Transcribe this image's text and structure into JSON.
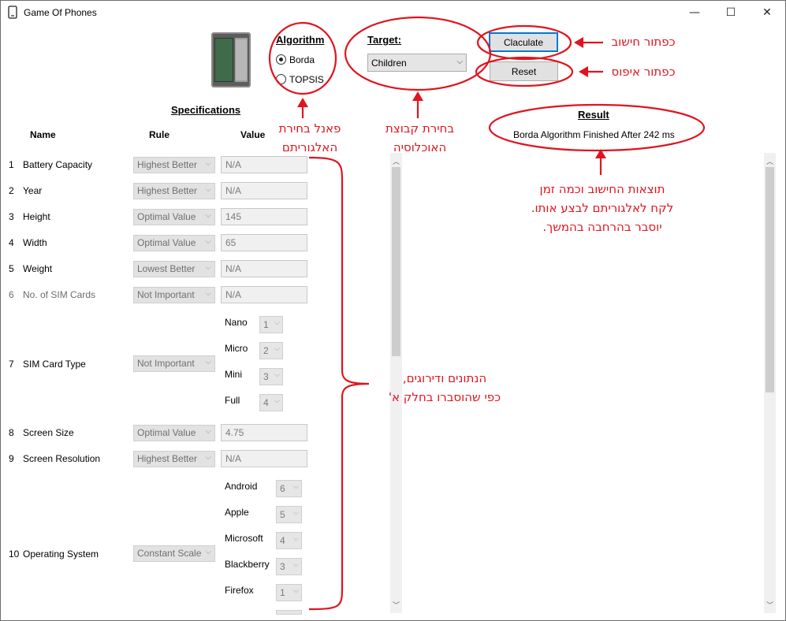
{
  "window": {
    "title": "Game Of Phones",
    "minimize_glyph": "—",
    "maximize_glyph": "☐",
    "close_glyph": "✕",
    "icon": "phone-icon"
  },
  "algorithm": {
    "heading": "Algorithm",
    "options": [
      {
        "label": "Borda",
        "selected": true
      },
      {
        "label": "TOPSIS",
        "selected": false
      }
    ]
  },
  "target": {
    "heading": "Target:",
    "selected": "Children"
  },
  "buttons": {
    "calculate": "Claculate",
    "reset": "Reset"
  },
  "result": {
    "heading": "Result",
    "text": "Borda Algorithm Finished After 242 ms"
  },
  "specs": {
    "heading": "Specifications",
    "columns": {
      "name": "Name",
      "rule": "Rule",
      "value": "Value"
    },
    "rows": [
      {
        "num": "1",
        "name": "Battery Capacity",
        "rule": "Highest Better",
        "value": "N/A"
      },
      {
        "num": "2",
        "name": "Year",
        "rule": "Highest Better",
        "value": "N/A"
      },
      {
        "num": "3",
        "name": "Height",
        "rule": "Optimal Value",
        "value": "145"
      },
      {
        "num": "4",
        "name": "Width",
        "rule": "Optimal Value",
        "value": "65"
      },
      {
        "num": "5",
        "name": "Weight",
        "rule": "Lowest Better",
        "value": "N/A"
      },
      {
        "num": "6",
        "name": "No. of SIM Cards",
        "rule": "Not Important",
        "value": "N/A"
      },
      {
        "num": "7",
        "name": "SIM Card Type",
        "rule": "Not Important"
      },
      {
        "num": "8",
        "name": "Screen Size",
        "rule": "Optimal Value",
        "value": "4.75"
      },
      {
        "num": "9",
        "name": "Screen Resolution",
        "rule": "Highest Better",
        "value": "N/A"
      },
      {
        "num": "10",
        "name": "Operating System",
        "rule": "Constant Scale"
      }
    ],
    "sim_types": [
      {
        "label": "Nano",
        "rank": "1"
      },
      {
        "label": "Micro",
        "rank": "2"
      },
      {
        "label": "Mini",
        "rank": "3"
      },
      {
        "label": "Full",
        "rank": "4"
      }
    ],
    "os_types": [
      {
        "label": "Android",
        "rank": "6"
      },
      {
        "label": "Apple",
        "rank": "5"
      },
      {
        "label": "Microsoft",
        "rank": "4"
      },
      {
        "label": "Blackberry",
        "rank": "3"
      },
      {
        "label": "Firefox",
        "rank": "1"
      }
    ]
  },
  "annotations": {
    "algorithm_panel": [
      "פאנל בחירת",
      "האלגוריתם"
    ],
    "target_select": [
      "בחירת קבוצת",
      "האוכלוסיה"
    ],
    "calc_button": "כפתור חישוב",
    "reset_button": "כפתור איפוס",
    "result_note": [
      "תוצאות החישוב וכמה זמן",
      "לקח לאלגוריתם לבצע אותו.",
      "יוסבר בהרחבה בהמשך."
    ],
    "data_note": [
      "הנתונים ודירוגים,",
      "כפי שהוסברו בחלק א'"
    ]
  },
  "colors": {
    "annotation_red": "#e0141e",
    "focus_blue": "#0078d7"
  }
}
